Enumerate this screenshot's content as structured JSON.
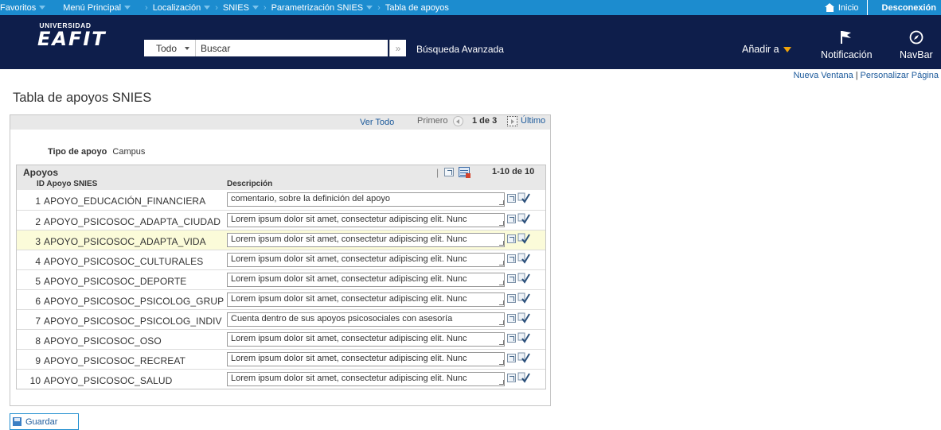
{
  "topnav": {
    "crumbs": [
      {
        "label": "Favoritos",
        "caret": true
      },
      {
        "label": "Menú Principal",
        "caret": true
      },
      {
        "label": "Localización",
        "caret": true
      },
      {
        "label": "SNIES",
        "caret": true
      },
      {
        "label": "Parametrización SNIES",
        "caret": true
      },
      {
        "label": "Tabla de apoyos",
        "caret": false
      }
    ],
    "home_label": "Inicio",
    "logout_label": "Desconexión"
  },
  "header": {
    "logo_top": "UNIVERSIDAD",
    "logo_brand": "EAFIT",
    "search_scope": "Todo",
    "search_placeholder": "Buscar",
    "advanced_search": "Búsqueda Avanzada",
    "add_to": "Añadir a",
    "notification": "Notificación",
    "navbar": "NavBar"
  },
  "links": {
    "new_window": "Nueva Ventana",
    "separator": "|",
    "personalize": "Personalizar Página"
  },
  "page_title": "Tabla de apoyos SNIES",
  "pager": {
    "view_all": "Ver Todo",
    "first": "Primero",
    "info": "1 de 3",
    "last": "Último"
  },
  "tipo": {
    "label": "Tipo de apoyo",
    "value": "Campus"
  },
  "grid": {
    "title": "Apoyos",
    "range": "1-10 de 10",
    "col_id": "ID Apoyo SNIES",
    "col_desc": "Descripción",
    "rows": [
      {
        "num": "1",
        "id": "APOYO_EDUCACIÓN_FINANCIERA",
        "desc": "comentario, sobre la definición del apoyo"
      },
      {
        "num": "2",
        "id": "APOYO_PSICOSOC_ADAPTA_CIUDAD",
        "desc": "Lorem ipsum dolor sit amet, consectetur adipiscing elit. Nunc"
      },
      {
        "num": "3",
        "id": "APOYO_PSICOSOC_ADAPTA_VIDA",
        "desc": "Lorem ipsum dolor sit amet, consectetur adipiscing elit. Nunc"
      },
      {
        "num": "4",
        "id": "APOYO_PSICOSOC_CULTURALES",
        "desc": "Lorem ipsum dolor sit amet, consectetur adipiscing elit. Nunc"
      },
      {
        "num": "5",
        "id": "APOYO_PSICOSOC_DEPORTE",
        "desc": "Lorem ipsum dolor sit amet, consectetur adipiscing elit. Nunc"
      },
      {
        "num": "6",
        "id": "APOYO_PSICOSOC_PSICOLOG_GRUP",
        "desc": "Lorem ipsum dolor sit amet, consectetur adipiscing elit. Nunc"
      },
      {
        "num": "7",
        "id": "APOYO_PSICOSOC_PSICOLOG_INDIV",
        "desc": "Cuenta dentro de sus apoyos psicosociales con asesoría"
      },
      {
        "num": "8",
        "id": "APOYO_PSICOSOC_OSO",
        "desc": "Lorem ipsum dolor sit amet, consectetur adipiscing elit. Nunc"
      },
      {
        "num": "9",
        "id": "APOYO_PSICOSOC_RECREAT",
        "desc": "Lorem ipsum dolor sit amet, consectetur adipiscing elit. Nunc"
      },
      {
        "num": "10",
        "id": "APOYO_PSICOSOC_SALUD",
        "desc": "Lorem ipsum dolor sit amet, consectetur adipiscing elit. Nunc"
      }
    ]
  },
  "save_label": "Guardar",
  "colors": {
    "top_bar": "#1c8ccf",
    "header": "#0e1e4b",
    "link": "#1c5a9b",
    "highlight_row": "#fbfbd9",
    "accent": "#f0a30a"
  },
  "icons": {
    "home": "home-icon",
    "flag": "flag-icon",
    "navbar": "compass-icon",
    "zoom": "zoom-icon",
    "excel": "spreadsheet-icon",
    "expand": "expand-icon",
    "spellcheck": "spellcheck-icon",
    "save": "save-icon"
  }
}
